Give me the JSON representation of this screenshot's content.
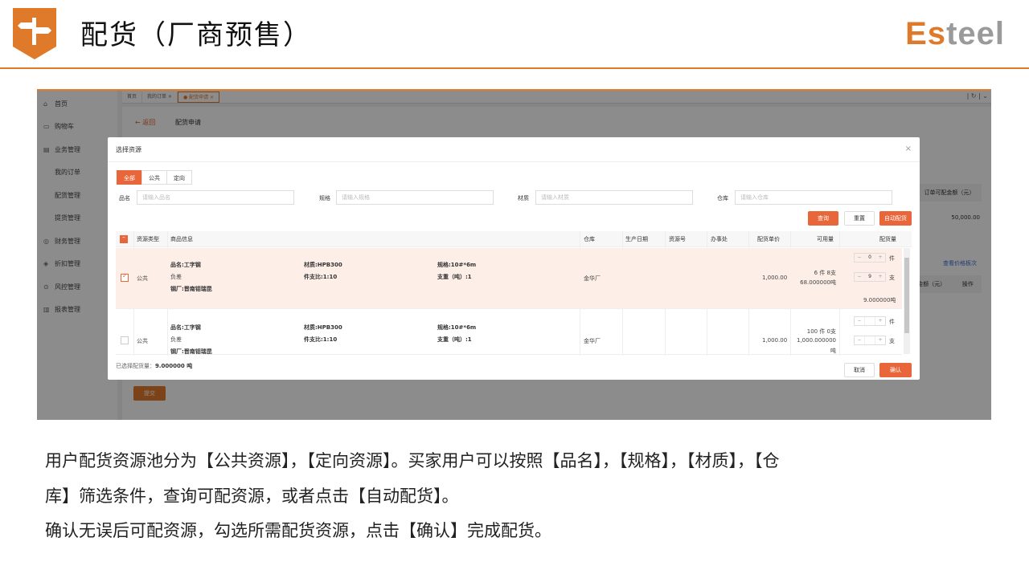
{
  "slide": {
    "title": "配货（厂商预售）",
    "brand_orange": "Es",
    "brand_gray": "teel",
    "accent": "#e07a2b",
    "desc_lines": [
      "用户配货资源池分为【公共资源】，【定向资源】。买家用户可以按照【品名】，【规格】，【材质】，【仓",
      "库】筛选条件，查询可配资源，或者点击【自动配货】。",
      "确认无误后可配资源，勾选所需配货资源，点击【确认】完成配货。"
    ]
  },
  "sidebar": {
    "items": [
      {
        "label": "首页",
        "icon": "⌂"
      },
      {
        "label": "购物车",
        "icon": "🛒"
      },
      {
        "label": "业务管理",
        "icon": "▤"
      },
      {
        "label": "我的订单",
        "icon": ""
      },
      {
        "label": "配货管理",
        "icon": ""
      },
      {
        "label": "提货管理",
        "icon": ""
      },
      {
        "label": "财务管理",
        "icon": "◎"
      },
      {
        "label": "折扣管理",
        "icon": "◈"
      },
      {
        "label": "风控管理",
        "icon": "⊙"
      },
      {
        "label": "报表管理",
        "icon": "▥"
      }
    ]
  },
  "tabs": [
    "首页",
    "我的订单 ×",
    "● 配货申请 ×"
  ],
  "content": {
    "back": "← 返回",
    "title": "配货申请",
    "submit": "提交",
    "right_col_head": "订单可配金额（元）",
    "right_val": "50,000.00",
    "right_link": "查看价格板次",
    "right_head_a": "金额（元）",
    "right_head_b": "操作"
  },
  "modal": {
    "title": "选择资源",
    "close": "×",
    "segments": [
      "全部",
      "公共",
      "定向"
    ],
    "filters": [
      {
        "label": "品名",
        "placeholder": "请输入品名"
      },
      {
        "label": "规格",
        "placeholder": "请输入规格"
      },
      {
        "label": "材质",
        "placeholder": "请输入材质"
      },
      {
        "label": "仓库",
        "placeholder": "请输入仓库"
      }
    ],
    "btn_query": "查询",
    "btn_reset": "重置",
    "btn_auto": "自动配货",
    "columns": [
      "资源类型",
      "商品信息",
      "仓库",
      "生产日期",
      "资源号",
      "办事处",
      "配货单价",
      "可用量",
      "配货量"
    ],
    "rows": [
      {
        "type": "公共",
        "name": "品名:工字钢",
        "tol": "负差",
        "mill": "钢厂:晋南钼瑞昆",
        "mat": "材质:HPB300",
        "ratio": "件支比:1:10",
        "spec": "规格:10#*6m",
        "wt": "支重（吨）:1",
        "wh": "金华厂",
        "price": "1,000.00",
        "avail1": "6 件 8支",
        "avail2": "68.000000吨",
        "avail3": "",
        "q1": "0",
        "q2": "9",
        "u1": "件",
        "u2": "支",
        "qty_total": "9.000000吨"
      },
      {
        "type": "公共",
        "name": "品名:工字钢",
        "tol": "负差",
        "mill": "钢厂:晋南钼瑞昆",
        "mat": "材质:HPB300",
        "ratio": "件支比:1:10",
        "spec": "规格:10#*6m",
        "wt": "支重（吨）:1",
        "wh": "金华厂",
        "price": "1,000.00",
        "avail1": "100 件 0支",
        "avail2": "1,000.000000",
        "avail3": "吨",
        "q1": "",
        "q2": "",
        "u1": "件",
        "u2": "支",
        "qty_total": ""
      }
    ],
    "selected_label": "已选择配货量：",
    "selected_value": "9.000000 吨",
    "btn_cancel": "取消",
    "btn_confirm": "确认"
  }
}
